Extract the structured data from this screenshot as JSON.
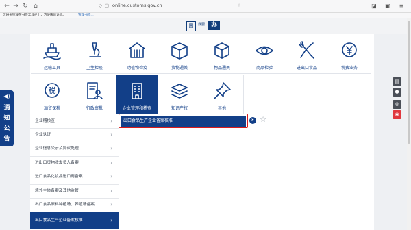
{
  "browser": {
    "url": "online.customs.gov.cn",
    "bookmark_notice": "可将书签放在书签工具栏上，方便快速访问。",
    "bookmark_link": "管理书签..."
  },
  "header": {
    "logo_box": "国",
    "logo_text": "我要",
    "logo_mark": "办"
  },
  "tiles": [
    {
      "label": "运输工具",
      "icon": "ship-icon"
    },
    {
      "label": "卫生检疫",
      "icon": "microscope-icon"
    },
    {
      "label": "动植物检疫",
      "icon": "barn-icon"
    },
    {
      "label": "货物通关",
      "icon": "box-icon"
    },
    {
      "label": "物品通关",
      "icon": "cube-icon"
    },
    {
      "label": "商品检验",
      "icon": "eye-icon"
    },
    {
      "label": "进出口食品",
      "icon": "fork-knife-icon"
    },
    {
      "label": "税费业务",
      "icon": "yuan-icon"
    },
    {
      "label": "加贸保税",
      "icon": "tax-icon"
    },
    {
      "label": "行政审批",
      "icon": "document-person-icon"
    },
    {
      "label": "企业管理和稽查",
      "icon": "building-icon",
      "active": true
    },
    {
      "label": "知识产权",
      "icon": "stack-icon"
    },
    {
      "label": "其他",
      "icon": "pin-icon"
    }
  ],
  "categories": [
    "企业稽核查",
    "企业认证",
    "企业信息公示及异议处理",
    "进出口货物收发货人备案",
    "进口食品化妆品进口商备案",
    "境外主体备案及其他监管",
    "出口食品原料种植场、养殖场备案",
    "出口食品生产企业备案核准"
  ],
  "active_category_index": 7,
  "service": {
    "label": "出口食品生产企业备案核准"
  },
  "notice": {
    "label": [
      "通",
      "知",
      "公",
      "告"
    ]
  },
  "side_tools": [
    "android-icon",
    "apple-icon",
    "wechat-icon",
    "weibo-icon"
  ],
  "colors": {
    "accent": "#123f88",
    "highlight": "#d81c1c"
  }
}
